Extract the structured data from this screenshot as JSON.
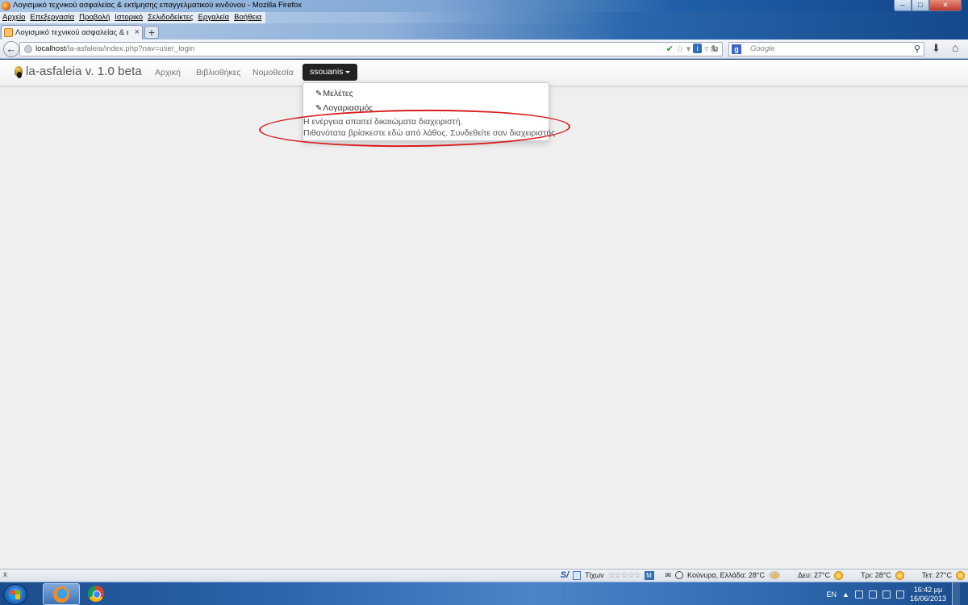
{
  "window": {
    "title": "Λογισμικό τεχνικού ασφαλείας & εκτίμησης επαγγελματικού κινδύνου - Mozilla Firefox",
    "controls": {
      "minimize": "–",
      "maximize": "□",
      "close": "✕"
    }
  },
  "menubar": {
    "items": [
      "Αρχείο",
      "Επεξεργασία",
      "Προβολή",
      "Ιστορικό",
      "Σελιδοδείκτες",
      "Εργαλεία",
      "Βοήθεια"
    ]
  },
  "tabs": [
    {
      "label": "Λογισμικό τεχνικού ασφαλείας & εκτίμη...",
      "close": "×"
    }
  ],
  "new_tab": "+",
  "toolbar": {
    "url_host": "localhost",
    "url_rest": "/la-asfaleia/index.php?nav=user_login",
    "search_placeholder": "Google",
    "search_engine_icon": "g"
  },
  "site": {
    "brand": "la-asfaleia v. 1.0 beta",
    "nav": [
      "Αρχική",
      "Βιβλιοθήκες",
      "Νομοθεσία"
    ],
    "user_menu": "ssouanis",
    "dropdown": {
      "items": [
        "Μελέτες",
        "Λογαριασμός"
      ],
      "message_line1": "Η ενέργεια απαιτεί δικαιώματα διαχειριστή.",
      "message_line2": "Πιθανότατα βρίσκεστε εδώ από λάθος. Συνδεθείτε σαν διαχειριστής"
    }
  },
  "annotation": {
    "color": "#d81e1e"
  },
  "statusbar": {
    "close": "x",
    "s_label": "S/",
    "tixon": "Τίχων",
    "stars": "☆☆☆☆☆",
    "m_label": "M",
    "weather": "Κούνυρα, Ελλάδα: 28°C",
    "day1": "Δευ: 27°C",
    "day2": "Τρι: 28°C",
    "day3": "Τετ: 27°C"
  },
  "taskbar": {
    "lang": "EN",
    "time": "16:42 μμ",
    "date": "16/06/2013"
  }
}
